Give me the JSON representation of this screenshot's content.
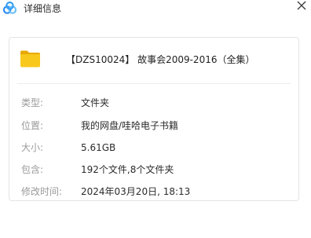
{
  "window": {
    "title": "详细信息",
    "logo_icon": "baidu-netdisk-logo-icon",
    "close_icon": "close-icon"
  },
  "file": {
    "icon": "folder-icon",
    "icon_color": "#f5c518",
    "name": "【DZS10024】 故事会2009-2016（全集）"
  },
  "details": [
    {
      "label": "类型:",
      "value": "文件夹"
    },
    {
      "label": "位置:",
      "value": "我的网盘/哇哈电子书籍"
    },
    {
      "label": "大小:",
      "value": "5.61GB"
    },
    {
      "label": "包含:",
      "value": "192个文件,8个文件夹"
    },
    {
      "label": "修改时间:",
      "value": "2024年03月20日, 18:13"
    }
  ],
  "colors": {
    "label": "#9a9a9a",
    "value": "#2b2b2b",
    "card_border": "#e4e4e4",
    "logo_blue": "#2e8cf0",
    "logo_light": "#6fc1f7"
  }
}
